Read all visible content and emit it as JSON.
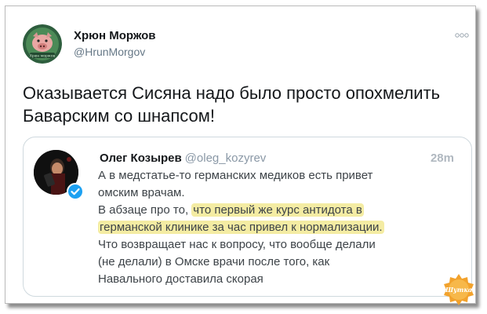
{
  "author": {
    "name": "Хрюн Моржов",
    "handle": "@HrunMorgov",
    "avatar_caption": "Хрюн моржов"
  },
  "tweet": {
    "line1": "Оказывается Сисяна надо было просто опохмелить",
    "line2": "Баварским со шнапсом!"
  },
  "quoted": {
    "name": "Олег Козырев",
    "handle": "@oleg_kozyrev",
    "time": "28m",
    "lines": {
      "l1": "А в медстатье-то германских медиков есть привет",
      "l2": "омским врачам.",
      "l3_pre": "В абзаце про то, ",
      "l3_hl": "что первый же курс антидота в",
      "l4_hl": "германской клинике за час привел к нормализации.",
      "l5": "Что возвращает нас к вопросу, что вообще делали",
      "l6": "(не делали) в Омске врачи после того, как",
      "l7": "Навального доставила скорая"
    }
  },
  "watermark": {
    "text": "Шутка"
  },
  "colors": {
    "highlight": "#f4eca3",
    "verified": "#1da1f2",
    "watermark": "#f2a22c"
  }
}
